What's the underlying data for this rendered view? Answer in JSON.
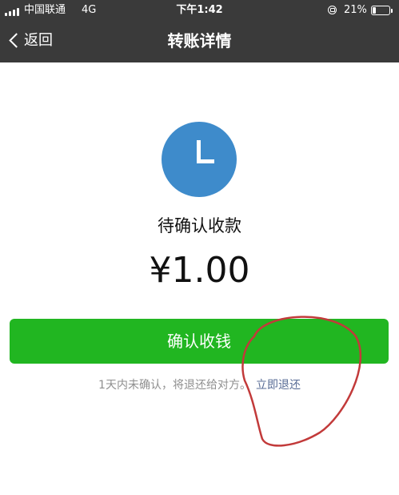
{
  "status_bar": {
    "carrier": "中国联通",
    "network": "4G",
    "time": "下午1:42",
    "battery_percent": "21%",
    "battery_level": 0.21
  },
  "nav": {
    "back_label": "返回",
    "title": "转账详情"
  },
  "transfer": {
    "status": "待确认收款",
    "amount": "¥1.00",
    "confirm_button_label": "确认收钱",
    "notice_text": "1天内未确认，将退还给对方。",
    "refund_link_label": "立即退还"
  },
  "icons": {
    "pending": "clock-icon",
    "back": "chevron-left-icon"
  },
  "colors": {
    "topbar": "#3a3a3a",
    "confirm_button": "#21b621",
    "clock_icon": "#3e8bcb",
    "link": "#576b95",
    "annotation": "#c23a3a"
  }
}
